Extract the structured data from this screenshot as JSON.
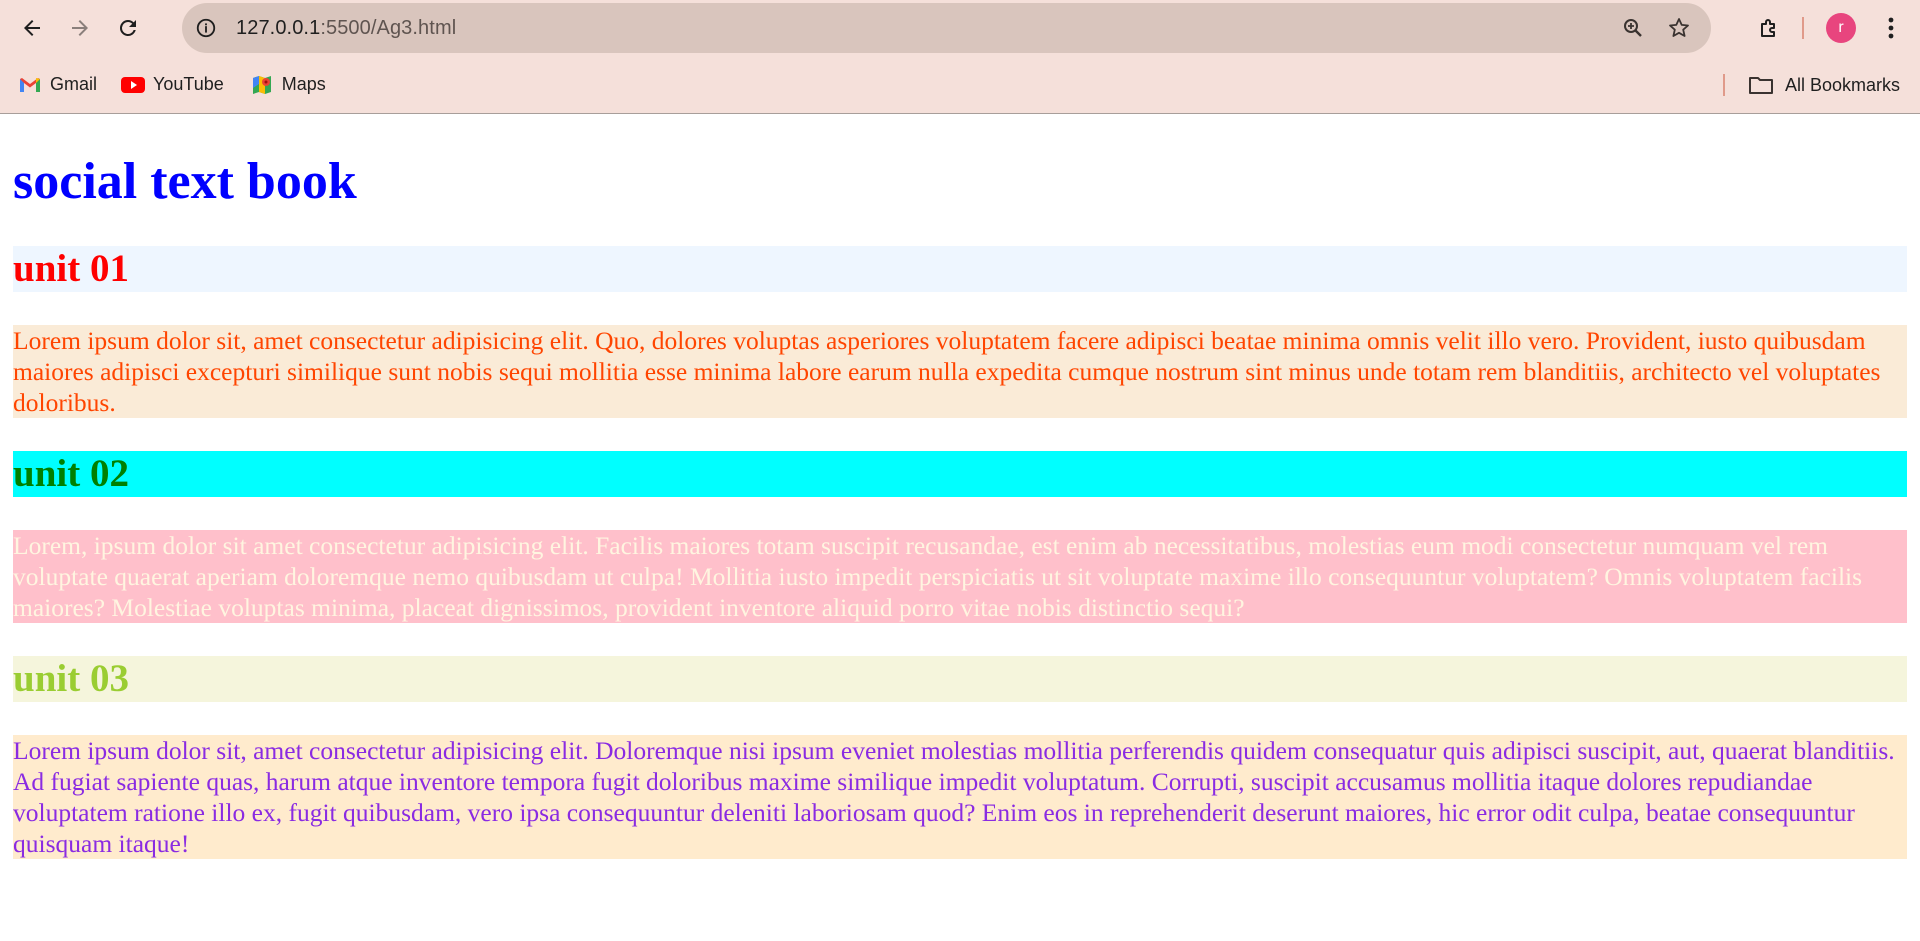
{
  "browser": {
    "url_host": "127.0.0.1",
    "url_path": ":5500/Ag3.html",
    "avatar_letter": "r",
    "avatar_color": "#e8457e",
    "chrome_color": "#f5e0da",
    "omnibox_color": "#d9c5bd"
  },
  "bookmarks": {
    "items": [
      {
        "label": "Gmail",
        "icon": "gmail-icon"
      },
      {
        "label": "YouTube",
        "icon": "youtube-icon"
      },
      {
        "label": "Maps",
        "icon": "maps-icon"
      }
    ],
    "all_label": "All Bookmarks"
  },
  "page": {
    "title": "social text book",
    "units": [
      {
        "heading": "unit 01",
        "heading_color": "#ff0000",
        "heading_bg": "#eef6ff",
        "text": "Lorem ipsum dolor sit, amet consectetur adipisicing elit. Quo, dolores voluptas asperiores voluptatem facere adipisci beatae minima omnis velit illo vero. Provident, iusto quibusdam maiores adipisci excepturi similique sunt nobis sequi mollitia esse minima labore earum nulla expedita cumque nostrum sint minus unde totam rem blanditiis, architecto vel voluptates doloribus.",
        "text_color": "#ff4500",
        "text_bg": "#faebd7"
      },
      {
        "heading": "unit 02",
        "heading_color": "#008000",
        "heading_bg": "#00ffff",
        "text": "Lorem, ipsum dolor sit amet consectetur adipisicing elit. Facilis maiores totam suscipit recusandae, est enim ab necessitatibus, molestias eum modi consectetur numquam vel rem voluptate quaerat aperiam doloremque nemo quibusdam ut culpa! Mollitia iusto impedit perspiciatis ut sit voluptate maxime illo consequuntur voluptatem? Omnis voluptatem facilis maiores? Molestiae voluptas minima, placeat dignissimos, provident inventore aliquid porro vitae nobis distinctio sequi?",
        "text_color": "#fff5e0",
        "text_bg": "#ffc0cb"
      },
      {
        "heading": "unit 03",
        "heading_color": "#9acd32",
        "heading_bg": "#f5f5dc",
        "text": "Lorem ipsum dolor sit, amet consectetur adipisicing elit. Doloremque nisi ipsum eveniet molestias mollitia perferendis quidem consequatur quis adipisci suscipit, aut, quaerat blanditiis. Ad fugiat sapiente quas, harum atque inventore tempora fugit doloribus maxime similique impedit voluptatum. Corrupti, suscipit accusamus mollitia itaque dolores repudiandae voluptatem ratione illo ex, fugit quibusdam, vero ipsa consequuntur deleniti laboriosam quod? Enim eos in reprehenderit deserunt maiores, hic error odit culpa, beatae consequuntur quisquam itaque!",
        "text_color": "#8a2be2",
        "text_bg": "#ffebcd"
      }
    ]
  }
}
